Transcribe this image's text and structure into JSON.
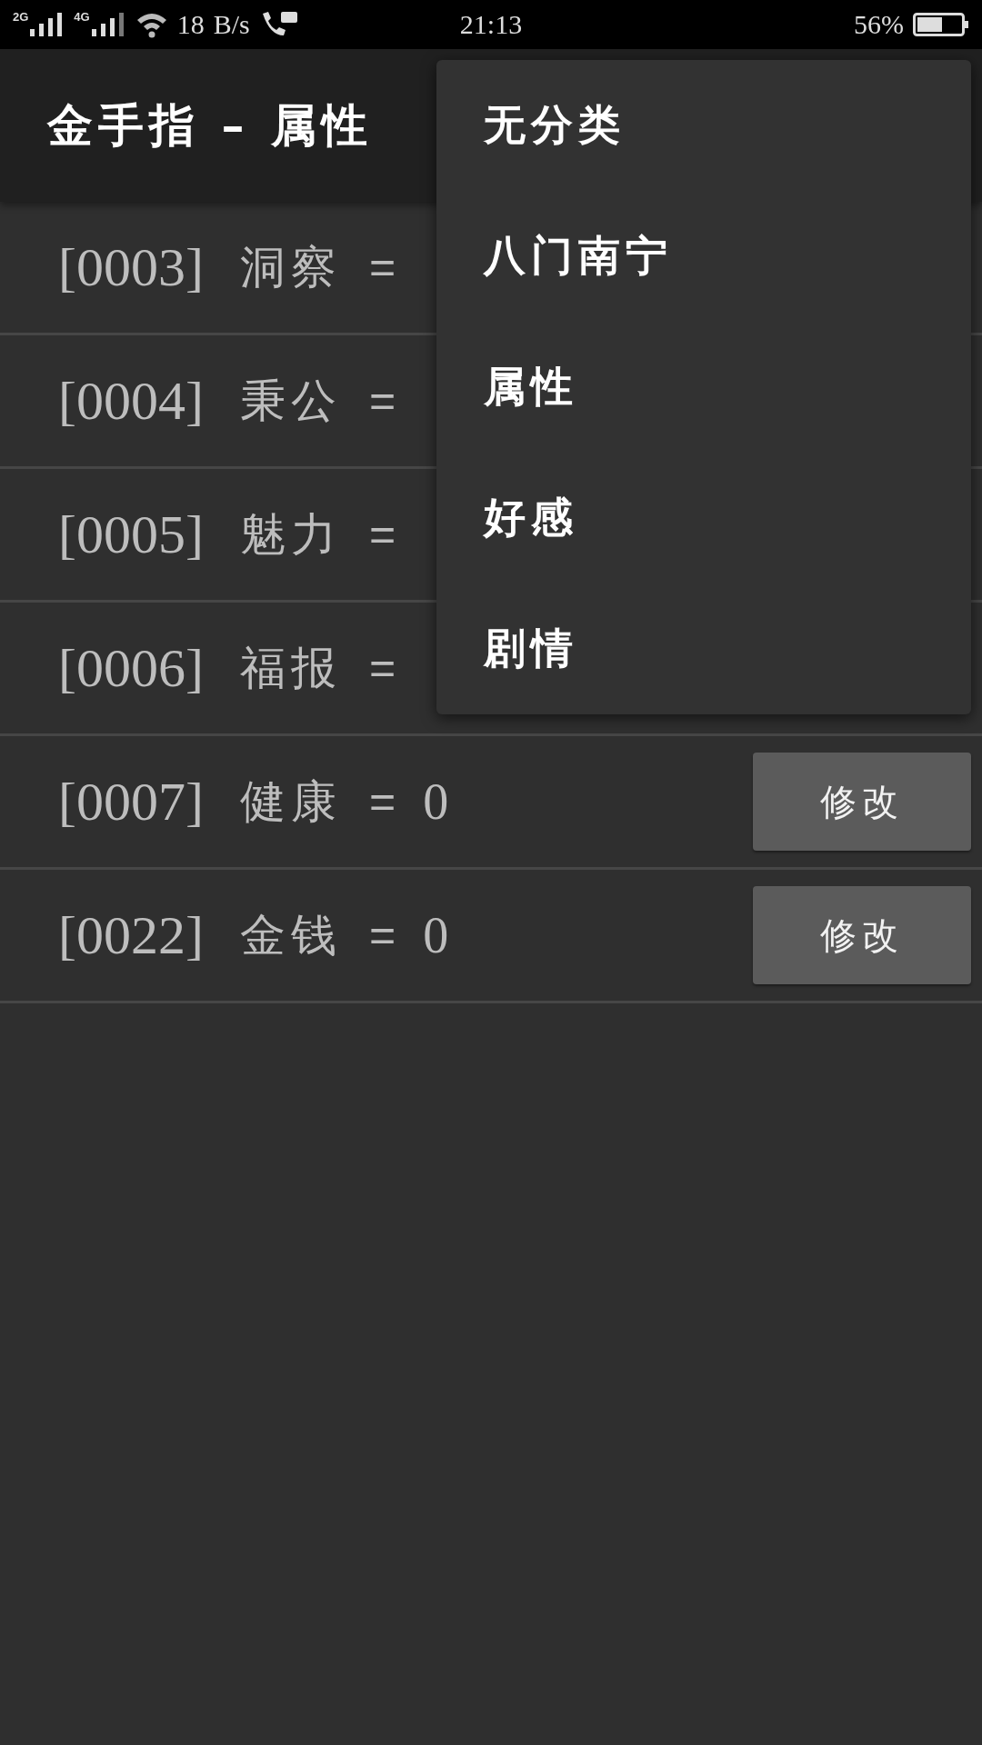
{
  "status_bar": {
    "networks": [
      "2G",
      "4G"
    ],
    "speed": "18",
    "speed_unit": "B/s",
    "time": "21:13",
    "battery": "56%"
  },
  "app_bar": {
    "title": "金手指 – 属性"
  },
  "rows": [
    {
      "id": "[0003]",
      "name": "洞察",
      "equals": "="
    },
    {
      "id": "[0004]",
      "name": "秉公",
      "equals": "="
    },
    {
      "id": "[0005]",
      "name": "魅力",
      "equals": "="
    },
    {
      "id": "[0006]",
      "name": "福报",
      "equals": "="
    },
    {
      "id": "[0007]",
      "name": "健康",
      "equals": "=",
      "value": "0",
      "button": "修改"
    },
    {
      "id": "[0022]",
      "name": "金钱",
      "equals": "=",
      "value": "0",
      "button": "修改"
    }
  ],
  "menu": {
    "items": [
      {
        "label": "无分类"
      },
      {
        "label": "八门南宁"
      },
      {
        "label": "属性"
      },
      {
        "label": "好感"
      },
      {
        "label": "剧情"
      }
    ]
  }
}
